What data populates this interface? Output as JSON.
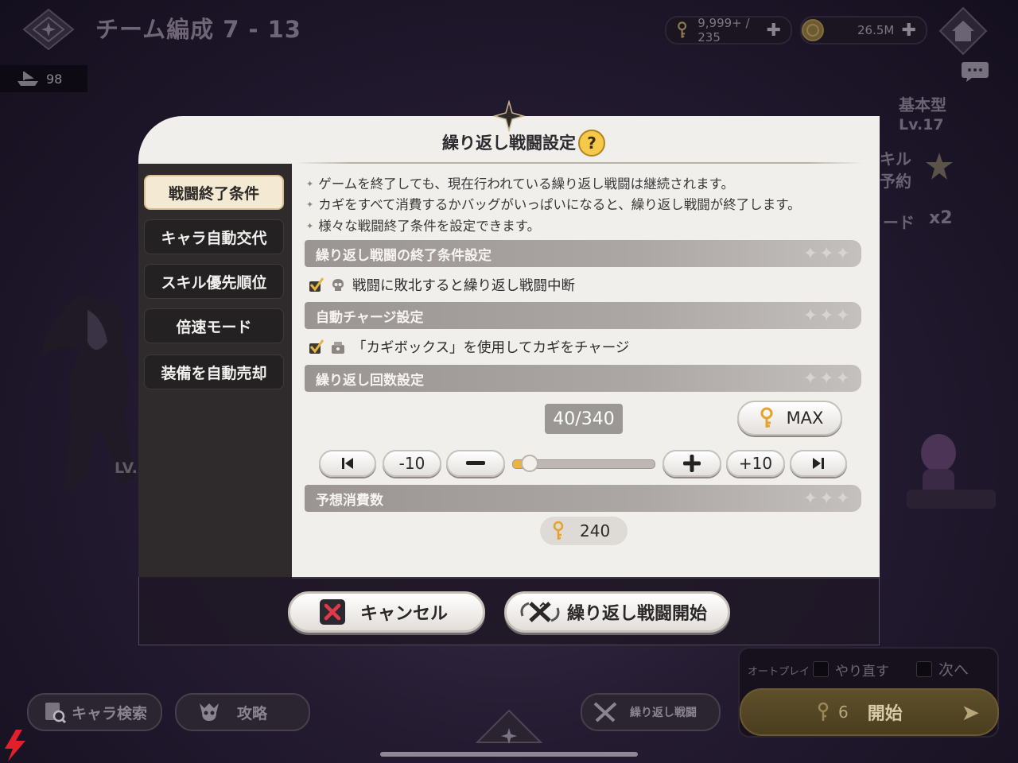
{
  "header": {
    "title": "チーム編成 7 - 13",
    "boat_count": "98",
    "keys": "9,999+ / 235",
    "coins": "26.5M"
  },
  "right_panel": {
    "type_label": "基本型",
    "level": "Lv.17",
    "skill_label_1": "キル",
    "skill_label_2": "予約",
    "mode_label": "ード",
    "multiplier": "x2"
  },
  "left_char": {
    "level_label": "LV."
  },
  "modal": {
    "title": "繰り返し戦闘設定",
    "help_icon": "question-icon",
    "tabs": [
      {
        "label": "戦闘終了条件",
        "active": true
      },
      {
        "label": "キャラ自動交代",
        "active": false
      },
      {
        "label": "スキル優先順位",
        "active": false
      },
      {
        "label": "倍速モード",
        "active": false
      },
      {
        "label": "装備を自動売却",
        "active": false
      }
    ],
    "notes": [
      "ゲームを終了しても、現在行われている繰り返し戦闘は継続されます。",
      "カギをすべて消費するかバッグがいっぱいになると、繰り返し戦闘が終了します。",
      "様々な戦闘終了条件を設定できます。"
    ],
    "sections": {
      "end_condition": {
        "header": "繰り返し戦闘の終了条件設定",
        "option": "戦闘に敗北すると繰り返し戦闘中断",
        "checked": true
      },
      "auto_charge": {
        "header": "自動チャージ設定",
        "option": "「カギボックス」を使用してカギをチャージ",
        "checked": true
      },
      "repeat_count": {
        "header": "繰り返し回数設定",
        "counter": "40/340",
        "max_label": "MAX",
        "minus10_label": "-10",
        "plus10_label": "+10",
        "slider_value": 40,
        "slider_max": 340
      },
      "expected_cost": {
        "header": "予想消費数",
        "value": "240"
      }
    },
    "cancel_label": "キャンセル",
    "start_label": "繰り返し戦闘開始"
  },
  "bottom": {
    "search_label": "キャラ検索",
    "strategy_label": "攻略",
    "repeat_label": "繰り返し戦闘",
    "autoplay_label": "オートプレイ",
    "redo_label": "やり直す",
    "next_label": "次へ",
    "start_cost": "6",
    "start_label": "開始"
  },
  "colors": {
    "accent_gold": "#f0b23a",
    "panel_bg": "#f1efec",
    "sidebar_bg": "#2f2b2d",
    "cancel_red": "#e03a4a"
  }
}
